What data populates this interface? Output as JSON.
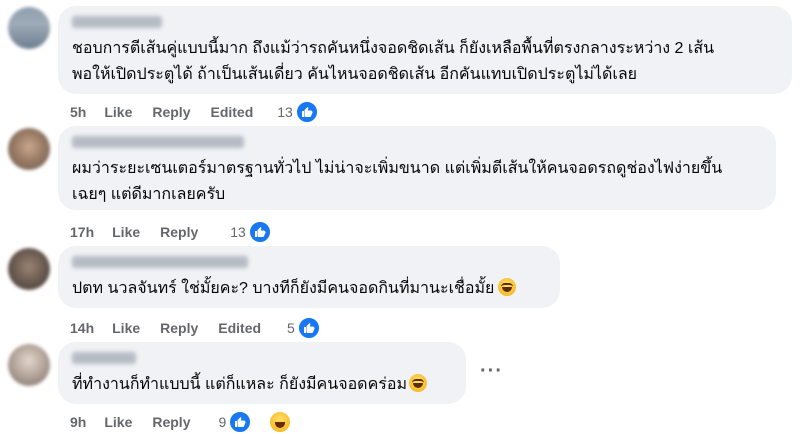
{
  "comments": [
    {
      "author": "",
      "text_lines": [
        "ชอบการตีเส้นคู่แบบนี้มาก ถึงแม้ว่ารถคันหนึ่งจอดชิดเส้น ก็ยังเหลือพื้นที่ตรงกลางระหว่าง 2 เส้น",
        "พอให้เปิดประตูได้ ถ้าเป็นเส้นเดี่ยว คันไหนจอดชิดเส้น อีกคันแทบเปิดประตูไม่ได้เลย"
      ],
      "time": "5h",
      "like": "Like",
      "reply": "Reply",
      "edited": "Edited",
      "reaction_count": "13",
      "reactions": [
        "like-icon"
      ]
    },
    {
      "author": "",
      "text_lines": [
        "ผมว่าระยะเซนเตอร์มาตรฐานทั่วไป ไม่น่าจะเพิ่มขนาด แต่เพิ่มตีเส้นให้คนจอดรถดูช่องไฟง่ายขึ้น",
        "เฉยๆ แต่ดีมากเลยครับ"
      ],
      "time": "17h",
      "like": "Like",
      "reply": "Reply",
      "reaction_count": "13",
      "reactions": [
        "like-icon"
      ]
    },
    {
      "author": "",
      "text_lines": [
        "ปตท นวลจันทร์ ใช่มั้ยคะ? บางทีก็ยังมีคนจอดกินที่มานะเชื่อมั้ย"
      ],
      "time": "14h",
      "like": "Like",
      "reply": "Reply",
      "edited": "Edited",
      "reaction_count": "5",
      "reactions": [
        "like-icon"
      ]
    },
    {
      "author": "",
      "text_lines": [
        "ที่ทำงานก็ทำแบบนี้ แต่ก็แหละ ก็ยังมีคนจอดคร่อม"
      ],
      "time": "9h",
      "like": "Like",
      "reply": "Reply",
      "reaction_count": "9",
      "reactions": [
        "like-icon",
        "haha-icon"
      ]
    }
  ],
  "more_button": "···",
  "colors": {
    "like_blue": "#1877f2",
    "bubble_bg": "#f0f2f5",
    "meta_gray": "#65676b"
  }
}
